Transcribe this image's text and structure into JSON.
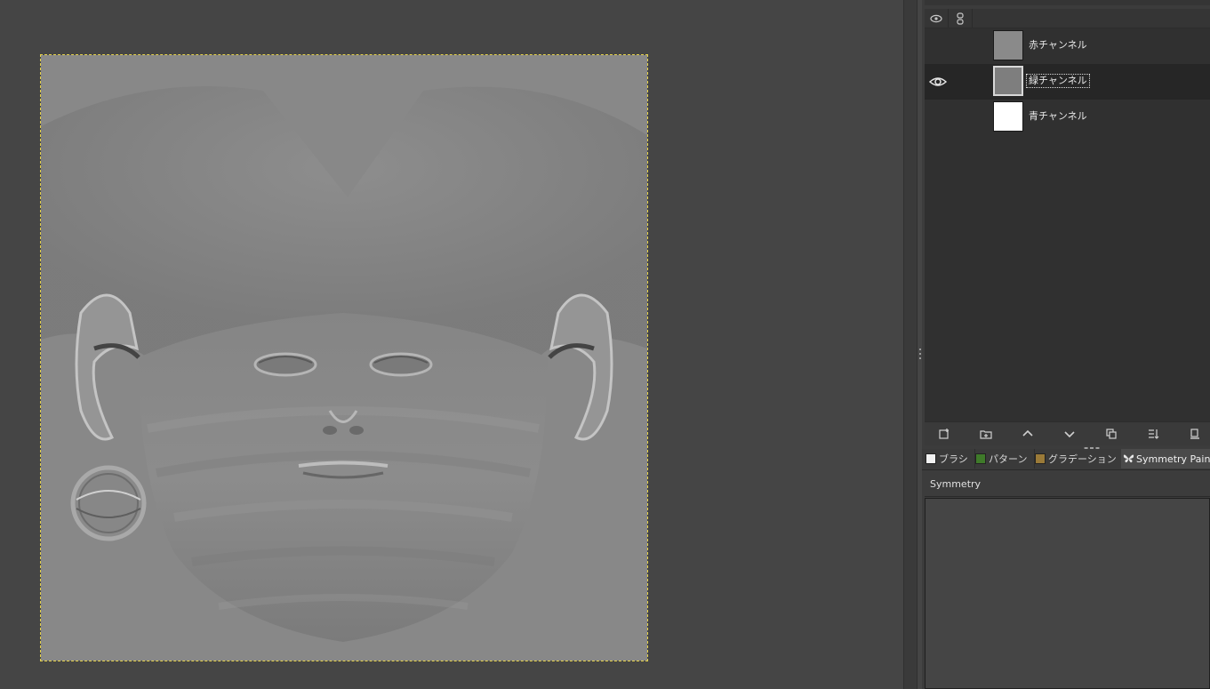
{
  "channels": {
    "header_icons": [
      "eye-icon",
      "chain-icon"
    ],
    "items": [
      {
        "label": "赤チャンネル",
        "visible": false,
        "selected": false,
        "thumb_color": "#8a8a8a"
      },
      {
        "label": "緑チャンネル",
        "visible": true,
        "selected": true,
        "thumb_color": "#7e7e7e"
      },
      {
        "label": "青チャンネル",
        "visible": false,
        "selected": false,
        "thumb_color": "#ffffff"
      }
    ],
    "toolbar_icons": [
      "new-channel-icon",
      "new-folder-icon",
      "raise-icon",
      "lower-icon",
      "duplicate-icon",
      "to-selection-icon",
      "delete-icon"
    ]
  },
  "tabs": [
    {
      "label": "ブラシ",
      "swatch": "#f2f2f2"
    },
    {
      "label": "パターン",
      "swatch": "#3f7a2a"
    },
    {
      "label": "グラデーション",
      "swatch": "#9a7a38"
    },
    {
      "label": "Symmetry Painting",
      "swatch": ""
    }
  ],
  "symmetry": {
    "title": "Symmetry"
  },
  "colors": {
    "canvas_bg": "#454545",
    "image_bg": "#888888",
    "boundary": "#e6d24a"
  }
}
